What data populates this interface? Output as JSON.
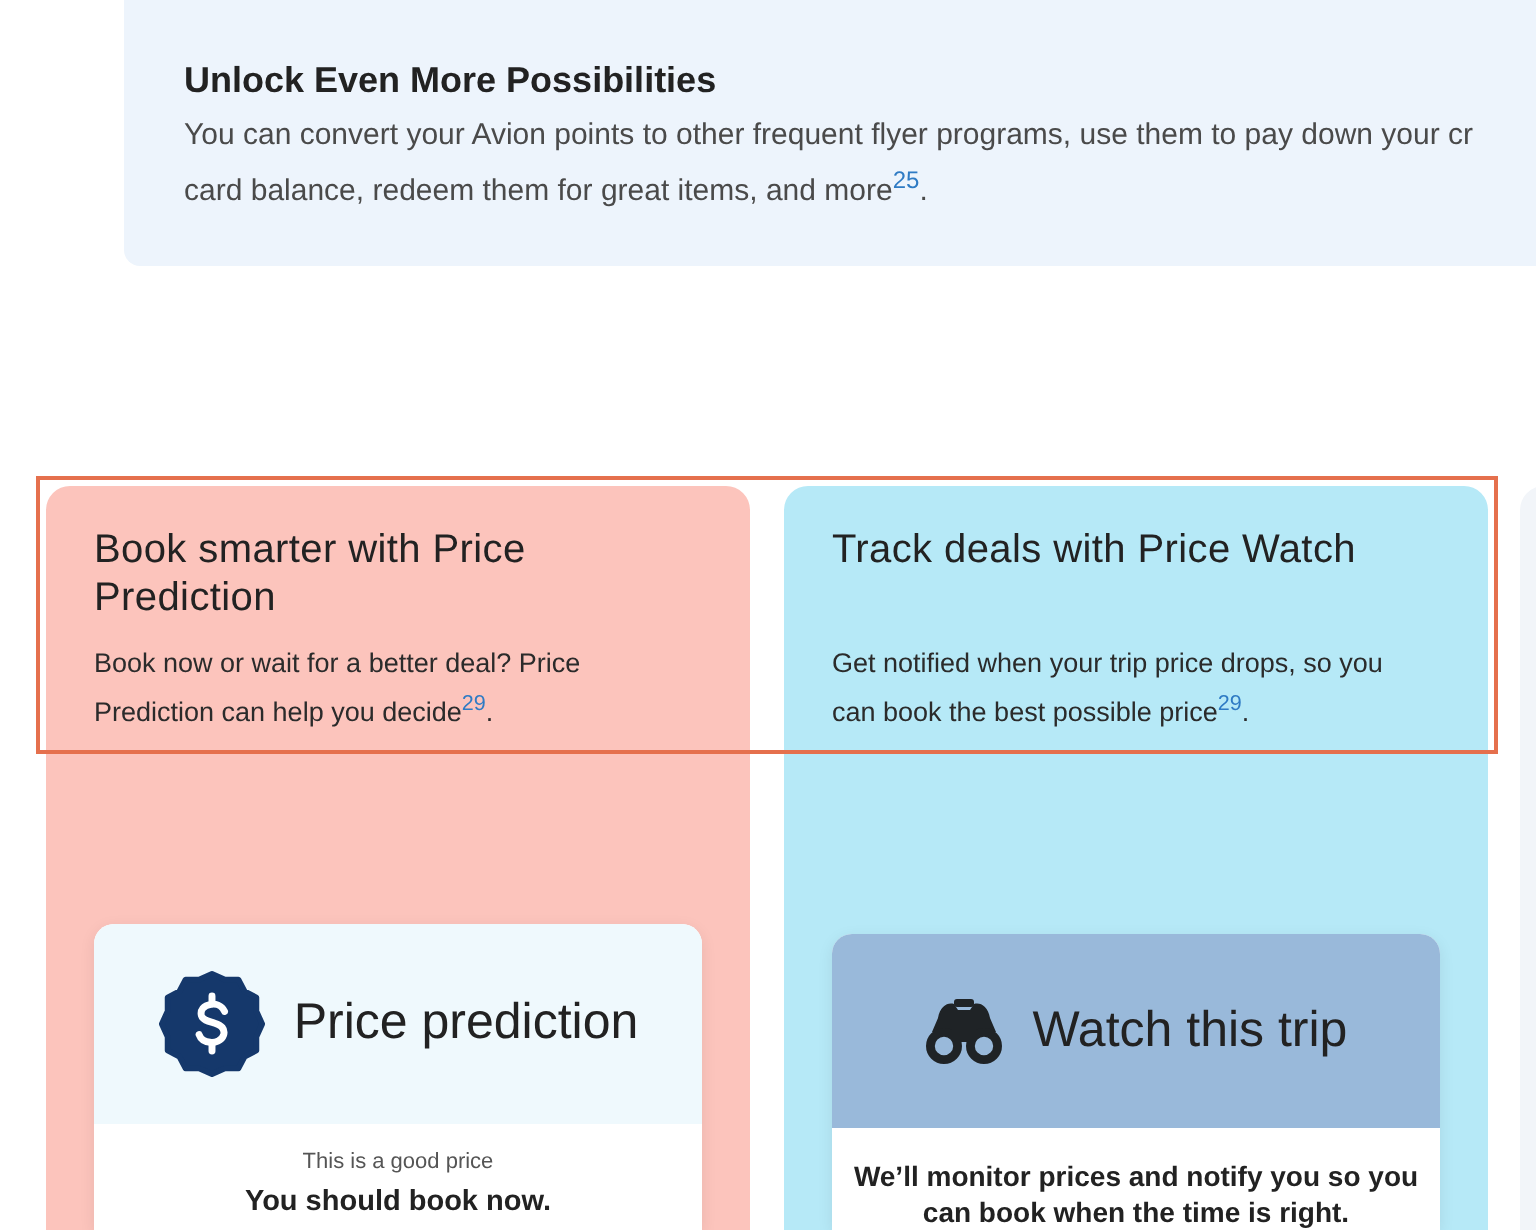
{
  "info_panel": {
    "title": "Unlock Even More Possibilities",
    "body_lines": [
      "You can convert your Avion points to other frequent flyer programs, use them to pay down your cr",
      "card balance, redeem them for great items, and more$^{25}$."
    ]
  },
  "feature_cards": [
    {
      "kind": "prediction",
      "heading": "Book smarter with Price Prediction",
      "description": "Book now or wait for a better deal? Price Prediction can help you decide$^{29}$.",
      "preview": {
        "title": "Price prediction",
        "caption": "This is a good price",
        "message": "You should book now."
      }
    },
    {
      "kind": "watch",
      "heading": "Track deals with Price Watch",
      "description": "Get notified when your trip price drops, so you can book the best possible price$^{29}$.",
      "preview": {
        "title": "Watch this trip",
        "message": "We’ll monitor prices and notify you so you can book when the time is right."
      }
    }
  ]
}
